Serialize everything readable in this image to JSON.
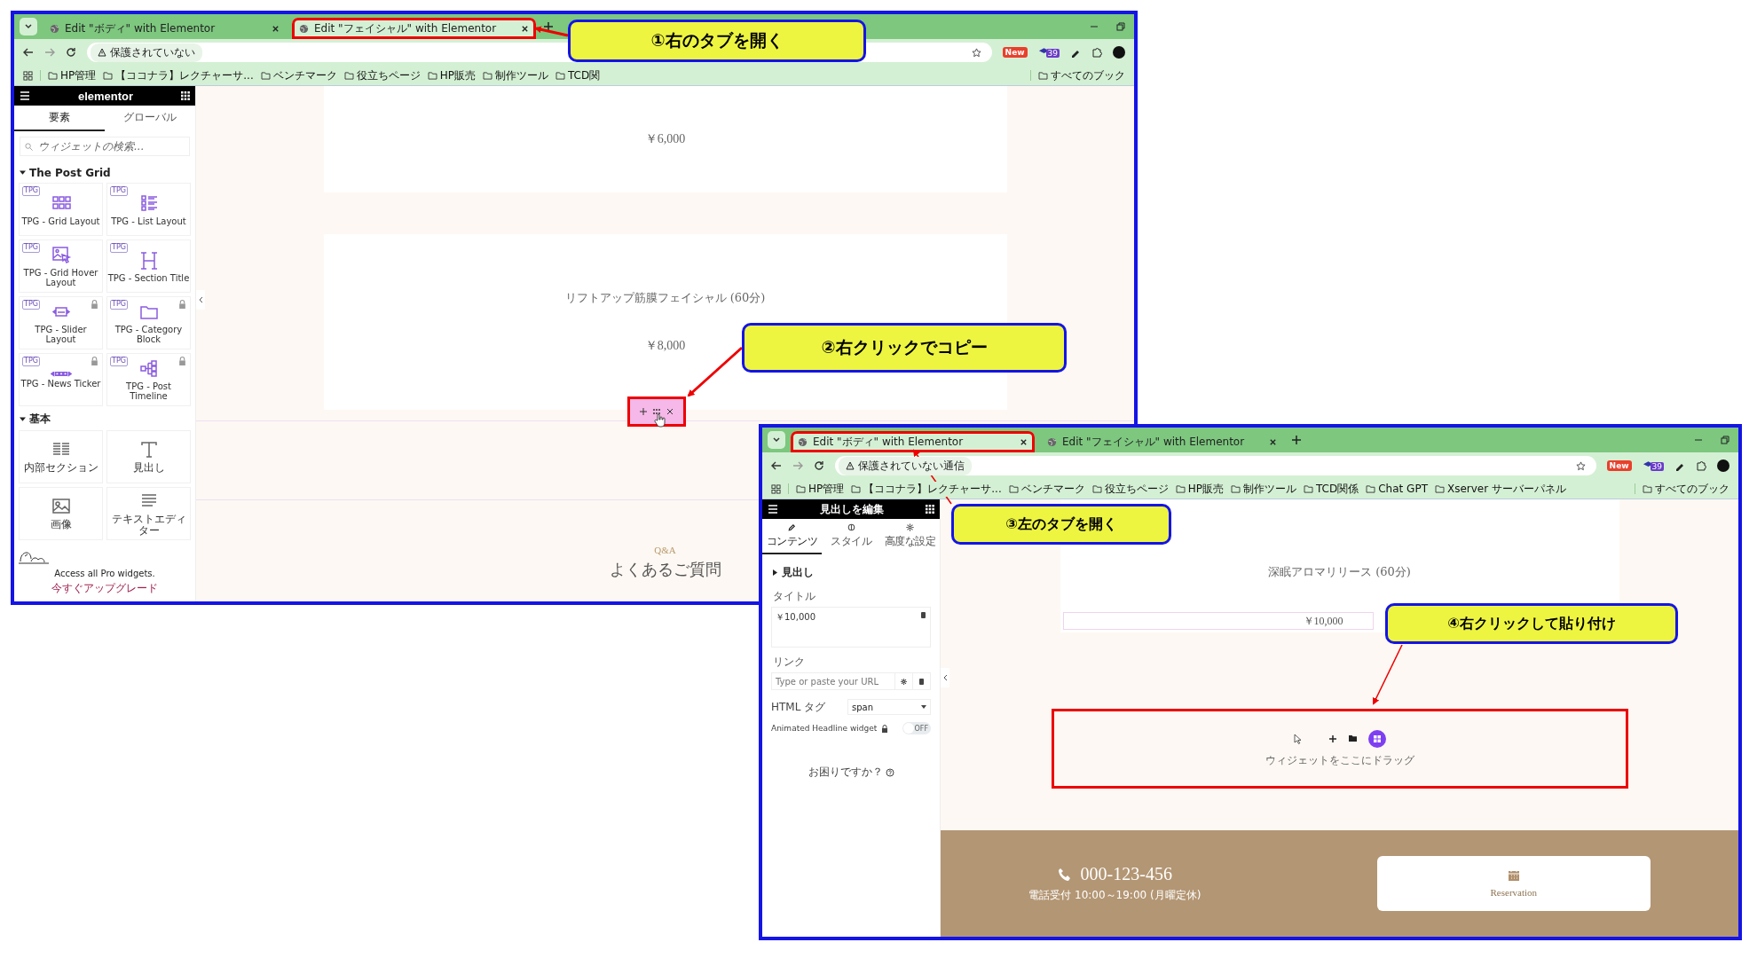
{
  "windows": [
    {
      "kind": "widgets",
      "tabs": [
        {
          "label": "Edit \"ボディ\" with Elementor",
          "selected": false,
          "highlighted": false
        },
        {
          "label": "Edit \"フェイシャル\" with Elementor",
          "selected": true,
          "highlighted": true
        }
      ],
      "address": "保護されていない",
      "extension_badges": [
        "New",
        "39"
      ],
      "bookmarks": [
        "HP管理",
        "【ココナラ】レクチャーサ...",
        "ベンチマーク",
        "役立ちページ",
        "HP販売",
        "制作ツール",
        "TCD関"
      ],
      "all_bookmarks": "すべてのブック",
      "sidebar": {
        "title": "elementor",
        "tabs": [
          {
            "label": "要素",
            "selected": true
          },
          {
            "label": "グローバル",
            "selected": false
          }
        ],
        "search": {
          "placeholder": "ウィジェットの検索..."
        },
        "categories": [
          {
            "title": "The Post Grid",
            "widgets": [
              {
                "badge": "TPG",
                "label": "TPG - Grid Layout",
                "locked": false
              },
              {
                "badge": "TPG",
                "label": "TPG - List Layout",
                "locked": false
              },
              {
                "badge": "TPG",
                "label": "TPG - Grid Hover Layout",
                "locked": false
              },
              {
                "badge": "TPG",
                "label": "TPG - Section Title",
                "locked": false
              },
              {
                "badge": "TPG",
                "label": "TPG - Slider Layout",
                "locked": true
              },
              {
                "badge": "TPG",
                "label": "TPG - Category Block",
                "locked": true
              },
              {
                "badge": "TPG",
                "label": "TPG - News Ticker",
                "locked": true
              },
              {
                "badge": "TPG",
                "label": "TPG - Post Timeline",
                "locked": true
              }
            ]
          },
          {
            "title": "基本",
            "widgets": [
              {
                "label": "内部セクション",
                "locked": false
              },
              {
                "label": "見出し",
                "locked": false
              },
              {
                "label": "画像",
                "locked": false
              },
              {
                "label": "テキストエディター",
                "locked": false
              }
            ]
          }
        ],
        "promo": "Access all Pro widgets.",
        "upgrade_link": "今すぐアップグレード"
      },
      "canvas": {
        "price_1": "￥6,000",
        "service_title": "リフトアップ筋膜フェイシャル (60分)",
        "price_2": "￥8,000",
        "handle_highlighted": true,
        "eyebrow": "Q&A",
        "heading": "よくあるご質問"
      }
    },
    {
      "kind": "heading-editor",
      "tabs": [
        {
          "label": "Edit \"ボディ\" with Elementor",
          "selected": true,
          "highlighted": true
        },
        {
          "label": "Edit \"フェイシャル\" with Elementor",
          "selected": false,
          "highlighted": false
        }
      ],
      "address": "保護されていない通信",
      "extension_badges": [
        "New",
        "39"
      ],
      "bookmarks": [
        "HP管理",
        "【ココナラ】レクチャーサ...",
        "ベンチマーク",
        "役立ちページ",
        "HP販売",
        "制作ツール",
        "TCD関係",
        "Chat GPT",
        "Xserver サーバーパネル"
      ],
      "all_bookmarks": "すべてのブック",
      "sidebar": {
        "title": "見出しを編集",
        "tabs": [
          {
            "label": "コンテンツ",
            "selected": true
          },
          {
            "label": "スタイル",
            "selected": false
          },
          {
            "label": "高度な設定",
            "selected": false
          }
        ],
        "section": "見出し",
        "title_label": "タイトル",
        "title_value": "￥10,000",
        "link_label": "リンク",
        "link_placeholder": "Type or paste your URL",
        "html_tag_label": "HTML タグ",
        "html_tag_value": "span",
        "animated_label": "Animated Headline widget",
        "toggle": {
          "on": false,
          "label": "OFF"
        },
        "help": "お困りですか？"
      },
      "canvas": {
        "service_title": "深眠アロマリリース (60分)",
        "price": "￥10,000",
        "drop_highlighted": true,
        "drop_hint": "ウィジェットをここにドラッグ",
        "phone": "000-123-456",
        "hours": "電話受付 10:00～19:00 (月曜定休)",
        "reservation": "Reservation"
      }
    }
  ],
  "callouts": [
    {
      "text": "①右のタブを開く"
    },
    {
      "text": "②右クリックでコピー"
    },
    {
      "text": "③左のタブを開く"
    },
    {
      "text": "④右クリックして貼り付け"
    }
  ]
}
